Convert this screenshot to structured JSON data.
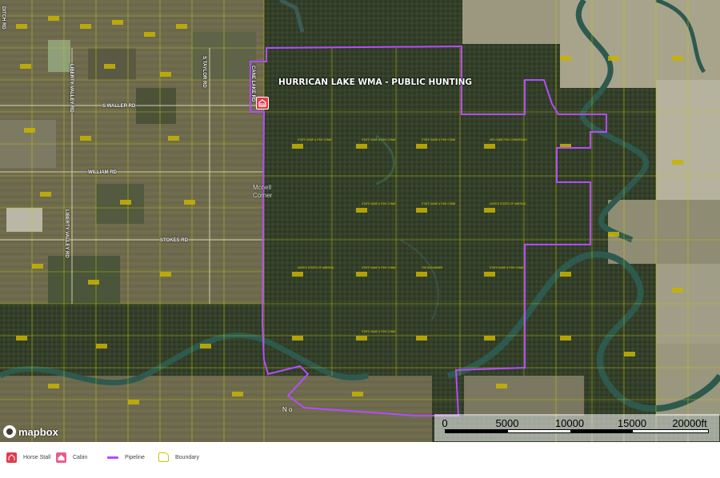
{
  "map": {
    "title": "HURRICAN LAKE WMA - PUBLIC HUNTING",
    "place_label_1": "Mcnell",
    "place_label_2": "Corner",
    "town_label": "N o",
    "road_labels": {
      "s_waller": "S WALLER RD",
      "s_taylor": "S TAYLOR RD",
      "liberty_valley": "LIBERTY VALLEY RD",
      "liberty_valley_2": "LIBERTY VALLEY RD",
      "william": "WILLIAM RD",
      "stokes": "STOKES RD",
      "cane_lake": "CANE LAKE RD",
      "ditch": "DITCH RD"
    },
    "parcel_labels": [
      "STATE GAME & FISH COMM",
      "STATE GAME & FISH COMM",
      "STATE GAME & FISH COMM",
      "ASS GAME FISH COMMISSION",
      "STATE GAME & FISH COMM",
      "STATE GAME & FISH COMM",
      "UNITED STATES OF AMERICA",
      "UNITED STATES OF AMERICA",
      "STATE GAME & FISH COMM",
      "THE ALEXANDER",
      "STATE GAME & FISH COMM",
      "STATE GAME & FISH COMM"
    ],
    "colors": {
      "boundary": "#c8c800",
      "pipeline": "#b34dff",
      "horse_stall": "#e03c4a",
      "cabin": "#e85d8c",
      "water": "#2e5a4e"
    },
    "markers": [
      {
        "type": "Horse Stall",
        "icon": "horse-stall-icon"
      }
    ]
  },
  "scale": {
    "ticks": [
      "0",
      "5000",
      "10000",
      "15000",
      "20000ft"
    ]
  },
  "attribution": {
    "logo_text": "mapbox"
  },
  "legend": {
    "items": [
      {
        "label": "Horse Stall",
        "icon": "horse-stall-icon"
      },
      {
        "label": "Cabin",
        "icon": "cabin-icon"
      },
      {
        "label": "Pipeline",
        "icon": "pipeline-line-icon"
      },
      {
        "label": "Boundary",
        "icon": "boundary-shape-icon"
      }
    ]
  }
}
